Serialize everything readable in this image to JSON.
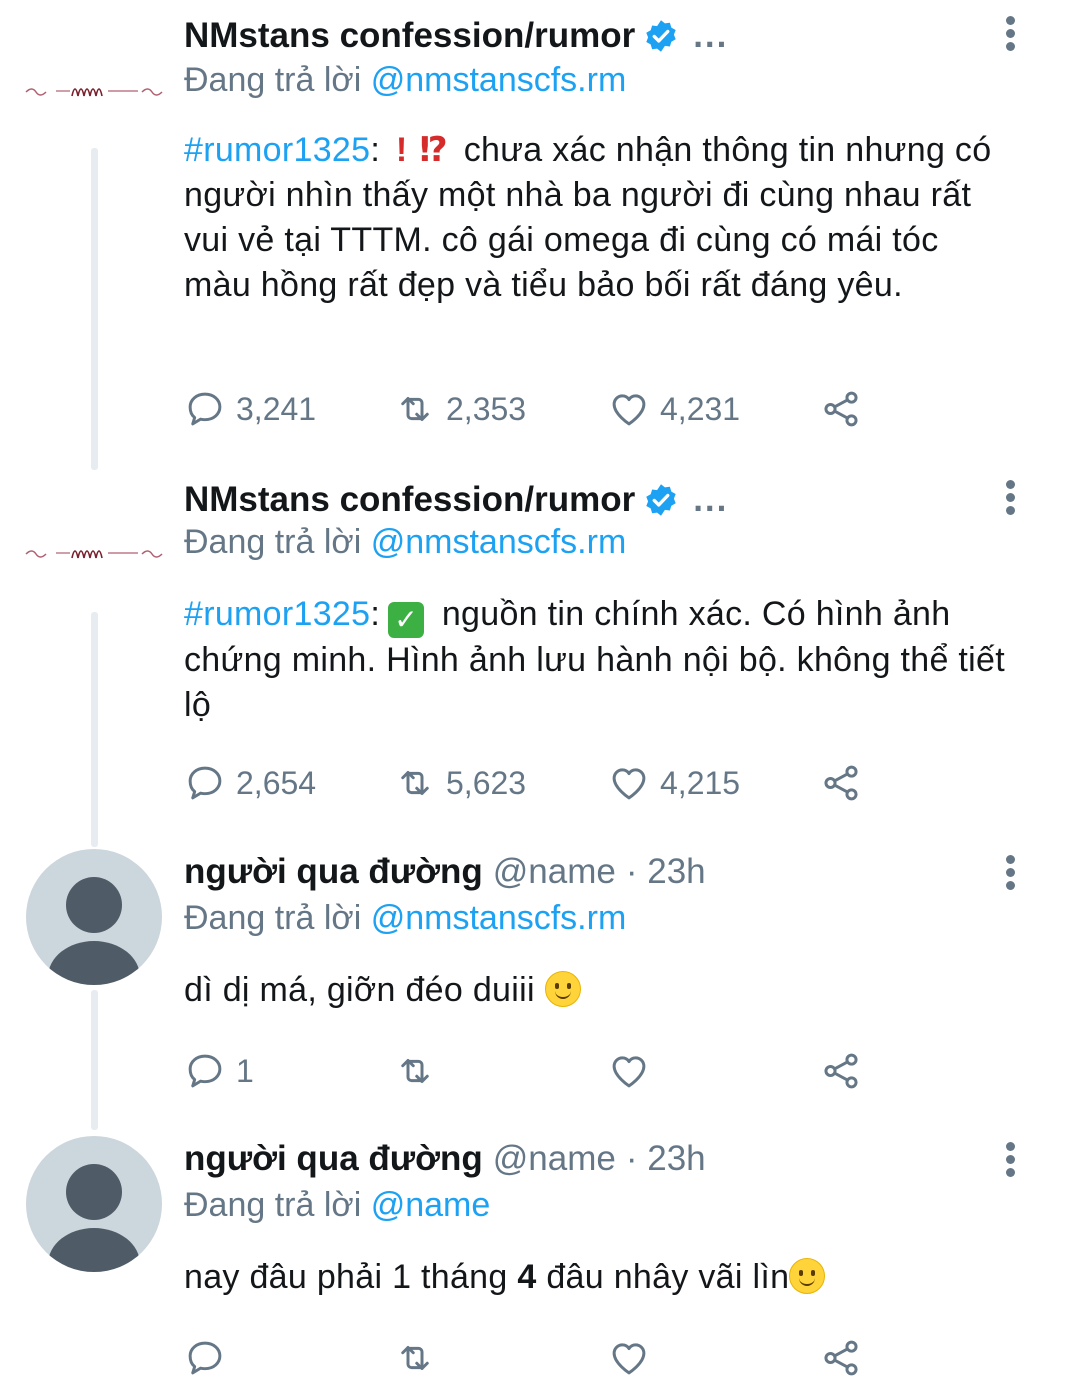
{
  "tweets": [
    {
      "name": "NMstans confession/rumor",
      "more": "...",
      "reply_prefix": "Đang trả lời",
      "reply_to": "@nmstanscfs.rm",
      "hashtag": "#rumor1325",
      "colon": ":",
      "emoji1": "!",
      "emoji2": "⁉",
      "text": "chưa xác nhận thông tin nhưng có người nhìn thấy một nhà ba người đi cùng nhau rất vui vẻ tại TTTM. cô gái omega đi cùng có mái tóc màu hồng rất đẹp và tiểu bảo bối rất đáng yêu.",
      "replies": "3,241",
      "retweets": "2,353",
      "likes": "4,231"
    },
    {
      "name": "NMstans confession/rumor",
      "more": "...",
      "reply_prefix": "Đang trả lời",
      "reply_to": "@nmstanscfs.rm",
      "hashtag": "#rumor1325",
      "colon": ":",
      "check": "✓",
      "text": "nguồn tin chính xác. Có hình ảnh chứng minh. Hình ảnh lưu hành nội bộ. không thể tiết  lộ",
      "replies": "2,654",
      "retweets": "5,623",
      "likes": "4,215"
    },
    {
      "name": "người qua đường",
      "handle": "@name",
      "time": "· 23h",
      "reply_prefix": "Đang trả lời",
      "reply_to": "@nmstanscfs.rm",
      "text": "dì dị má, giỡn đéo duiii",
      "replies": "1",
      "retweets": "",
      "likes": ""
    },
    {
      "name": "người qua đường",
      "handle": "@name",
      "time": "· 23h",
      "reply_prefix": "Đang trả lời",
      "reply_to": "@name",
      "text_a": "nay đâu phải 1 tháng ",
      "text_b": "4",
      "text_c": " đâu nhây vãi lìn",
      "replies": "",
      "retweets": "",
      "likes": ""
    }
  ],
  "icons": {
    "reply": "reply-icon",
    "retweet": "retweet-icon",
    "like": "heart-icon",
    "share": "share-icon",
    "verified": "verified-badge-icon",
    "more": "more-vertical-icon"
  },
  "colors": {
    "accent": "#1da1f2",
    "muted": "#657786",
    "text": "#14171a",
    "thread": "#e6ecf0",
    "avatar": "#ccd6dd"
  }
}
